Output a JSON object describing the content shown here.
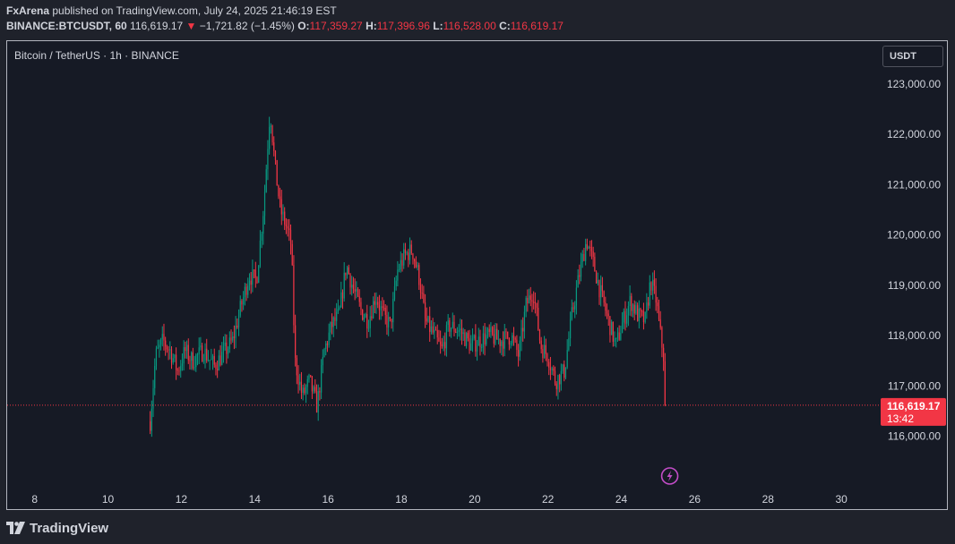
{
  "header": {
    "publisher": "FxArena",
    "published_text": " published on TradingView.com, July 24, 2025 21:46:19 EST",
    "symbol": "BINANCE:BTCUSDT, 60",
    "last": "116,619.17",
    "change": "−1,721.82 (−1.45%)",
    "o_label": "O:",
    "o_val": "117,359.27",
    "h_label": "H:",
    "h_val": "117,396.96",
    "l_label": "L:",
    "l_val": "116,528.00",
    "c_label": "C:",
    "c_val": "116,619.17",
    "down_arrow": "▼"
  },
  "instrument_title": "Bitcoin / TetherUS · 1h · BINANCE",
  "currency_button": "USDT",
  "price_label": {
    "price": "116,619.17",
    "countdown": "13:42"
  },
  "footer": {
    "brand": "TradingView"
  },
  "colors": {
    "up": "#089981",
    "down": "#f23645",
    "grid": "#1e222d",
    "text": "#d1d4dc",
    "event": "#c34dc8"
  },
  "chart_data": {
    "type": "candlestick",
    "x_tick_labels": [
      "8",
      "10",
      "12",
      "14",
      "16",
      "18",
      "20",
      "22",
      "24",
      "26",
      "28",
      "30"
    ],
    "y_tick_labels": [
      "123,000.00",
      "122,000.00",
      "121,000.00",
      "120,000.00",
      "119,000.00",
      "118,000.00",
      "117,000.00",
      "116,000.00"
    ],
    "y_ticks": [
      123000,
      122000,
      121000,
      120000,
      119000,
      118000,
      117000,
      116000
    ],
    "ylim": [
      115000,
      123850
    ],
    "xlim_days": [
      7.25,
      30.95
    ],
    "last_price": 116619.17,
    "grid": false,
    "price_path": [
      [
        11.15,
        116300
      ],
      [
        11.3,
        117600
      ],
      [
        11.5,
        117900
      ],
      [
        11.7,
        117700
      ],
      [
        11.9,
        117300
      ],
      [
        12.1,
        117700
      ],
      [
        12.3,
        117500
      ],
      [
        12.6,
        117700
      ],
      [
        12.9,
        117400
      ],
      [
        13.1,
        117600
      ],
      [
        13.4,
        117900
      ],
      [
        13.6,
        118500
      ],
      [
        13.85,
        119200
      ],
      [
        14.05,
        119100
      ],
      [
        14.25,
        120600
      ],
      [
        14.42,
        122500
      ],
      [
        14.55,
        121400
      ],
      [
        14.7,
        120500
      ],
      [
        14.85,
        120200
      ],
      [
        15.0,
        119800
      ],
      [
        15.1,
        117500
      ],
      [
        15.3,
        116800
      ],
      [
        15.5,
        117100
      ],
      [
        15.7,
        116600
      ],
      [
        15.9,
        117700
      ],
      [
        16.1,
        118200
      ],
      [
        16.3,
        118400
      ],
      [
        16.5,
        119400
      ],
      [
        16.7,
        118900
      ],
      [
        16.9,
        118500
      ],
      [
        17.1,
        118300
      ],
      [
        17.3,
        118800
      ],
      [
        17.5,
        118400
      ],
      [
        17.7,
        118200
      ],
      [
        17.9,
        119300
      ],
      [
        18.1,
        119600
      ],
      [
        18.3,
        119700
      ],
      [
        18.5,
        119100
      ],
      [
        18.65,
        118300
      ],
      [
        18.9,
        118000
      ],
      [
        19.1,
        117700
      ],
      [
        19.3,
        118200
      ],
      [
        19.6,
        118100
      ],
      [
        19.9,
        117800
      ],
      [
        20.1,
        117900
      ],
      [
        20.4,
        118000
      ],
      [
        20.7,
        117900
      ],
      [
        21.0,
        118000
      ],
      [
        21.2,
        117600
      ],
      [
        21.4,
        118600
      ],
      [
        21.6,
        118900
      ],
      [
        21.8,
        117800
      ],
      [
        22.0,
        117600
      ],
      [
        22.2,
        117100
      ],
      [
        22.45,
        117300
      ],
      [
        22.65,
        118400
      ],
      [
        22.85,
        119200
      ],
      [
        23.05,
        119900
      ],
      [
        23.25,
        119400
      ],
      [
        23.45,
        118800
      ],
      [
        23.65,
        118300
      ],
      [
        23.85,
        117800
      ],
      [
        24.05,
        118300
      ],
      [
        24.25,
        118700
      ],
      [
        24.45,
        118400
      ],
      [
        24.65,
        118300
      ],
      [
        24.8,
        119100
      ],
      [
        24.95,
        118700
      ],
      [
        25.05,
        118100
      ],
      [
        25.15,
        117600
      ],
      [
        25.2,
        116619
      ]
    ],
    "event_day": 25.32
  }
}
